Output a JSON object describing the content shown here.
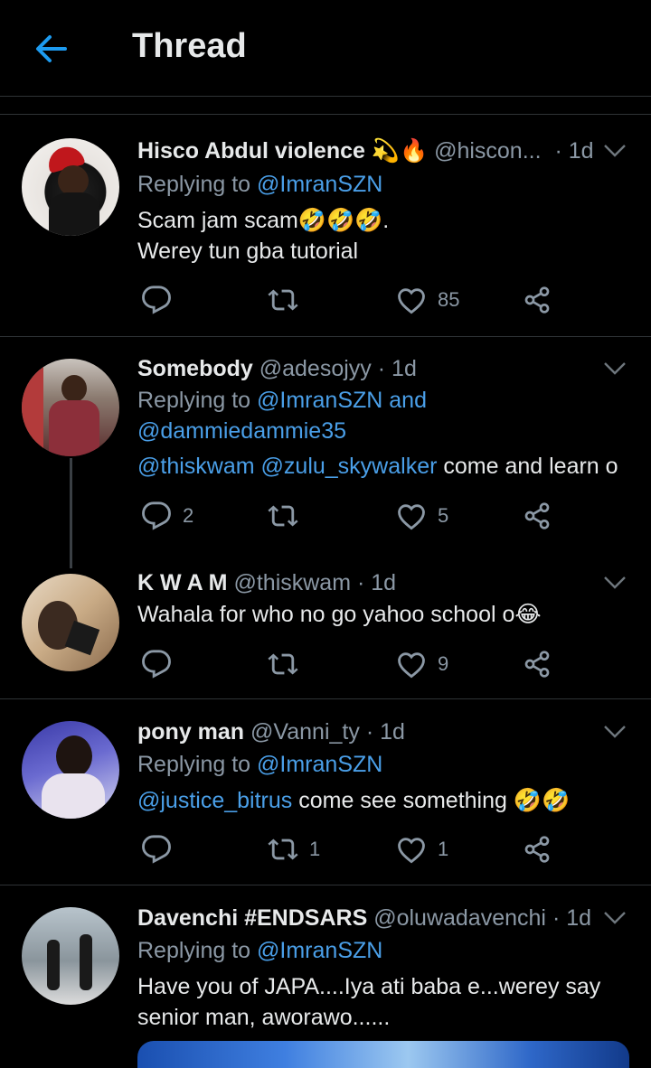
{
  "header": {
    "title": "Thread"
  },
  "tweets": [
    {
      "name": "Hisco Abdul violence 💫🔥",
      "handle": "@hiscon...",
      "time": "· 1d",
      "reply_label": "Replying to",
      "reply_to": "@ImranSZN",
      "text_lines": [
        "Scam jam scam",
        "Werey tun gba tutorial"
      ],
      "text_suffix": ".",
      "emoji": "🤣🤣🤣",
      "replies": "",
      "retweets": "",
      "likes": "85"
    },
    {
      "name": "Somebody",
      "handle": "@adesojyy",
      "time": "· 1d",
      "reply_label": "Replying to",
      "reply_to": "@ImranSZN and",
      "reply_to_2": "@dammiedammie35",
      "mention1": "@thiskwam",
      "mention2": "@zulu_skywalker",
      "text": "come and learn o",
      "replies": "2",
      "retweets": "",
      "likes": "5"
    },
    {
      "name": "K W A M",
      "handle": "@thiskwam",
      "time": "· 1d",
      "text": "Wahala for who no go yahoo school o",
      "emoji": "😂",
      "replies": "",
      "retweets": "",
      "likes": "9"
    },
    {
      "name": "pony man",
      "handle": "@Vanni_ty",
      "time": "· 1d",
      "reply_label": "Replying to",
      "reply_to": "@ImranSZN",
      "mention1": "@justice_bitrus",
      "text": "come see something",
      "emoji": "🤣🤣",
      "replies": "",
      "retweets": "1",
      "likes": "1"
    },
    {
      "name": "Davenchi #ENDSARS",
      "handle": "@oluwadavenchi",
      "time": "· 1d",
      "reply_label": "Replying to",
      "reply_to": "@ImranSZN",
      "text_lines": [
        "Have you of JAPA....Iya ati baba e...werey say",
        "senior man, aworawo......"
      ]
    }
  ],
  "colors": {
    "accent": "#1d9bf0",
    "link": "#4a9fe8",
    "muted": "#8b98a5",
    "background": "#000000",
    "divider": "#2f3336"
  }
}
